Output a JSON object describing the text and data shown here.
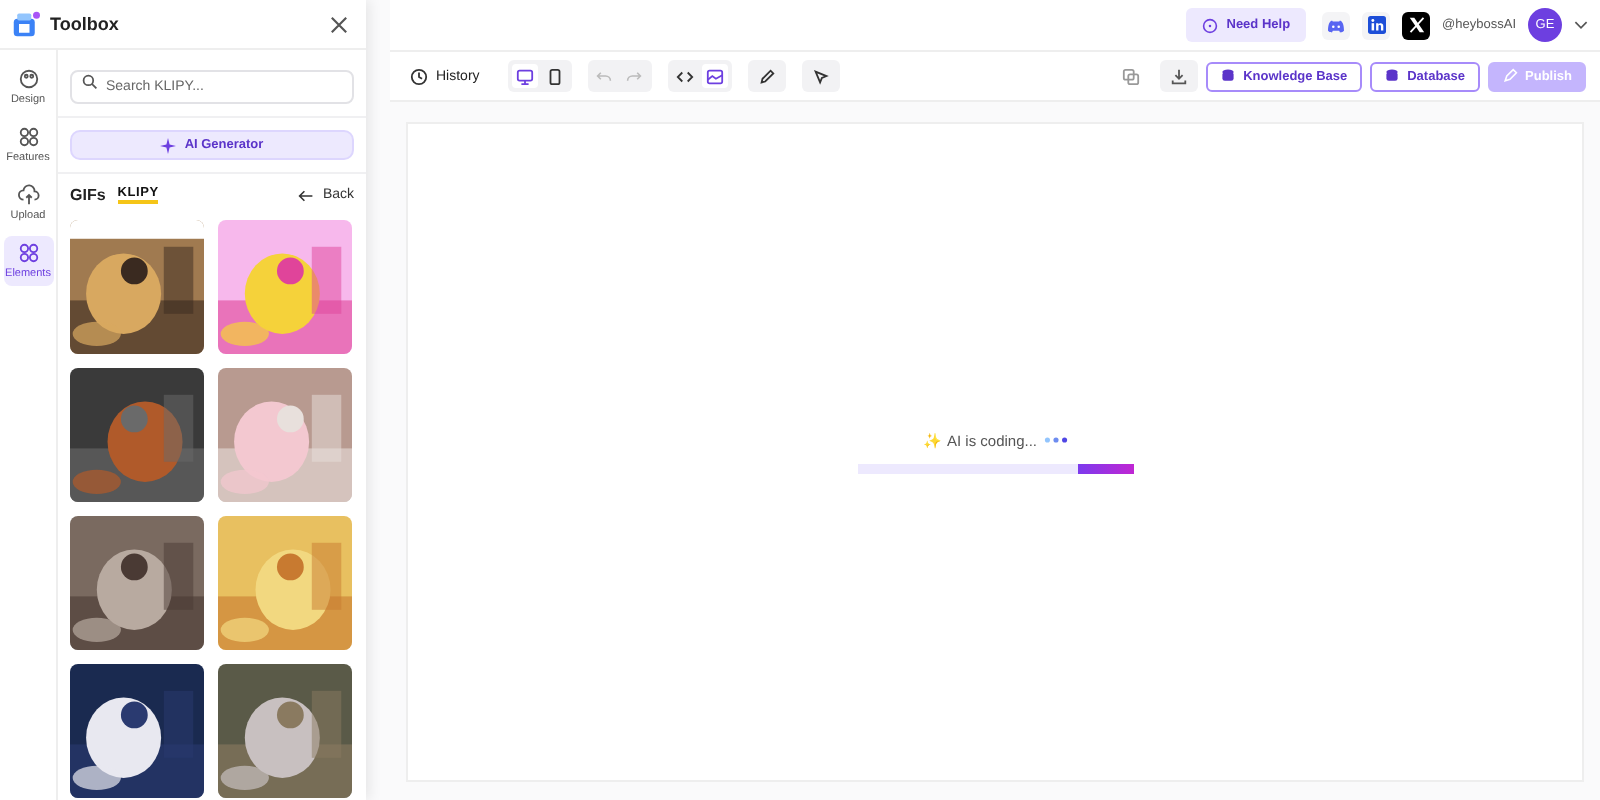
{
  "toolbox": {
    "title": "Toolbox",
    "rail": [
      {
        "kind": "design",
        "label": "Design",
        "selected": false
      },
      {
        "kind": "features",
        "label": "Features",
        "selected": false
      },
      {
        "kind": "upload",
        "label": "Upload",
        "selected": false
      },
      {
        "kind": "elements",
        "label": "Elements",
        "selected": true
      }
    ],
    "search": {
      "placeholder": "Search KLIPY..."
    },
    "ai_button": "AI Generator",
    "section": {
      "title": "GIFs",
      "provider": "KLIPY",
      "back": "Back"
    }
  },
  "topbar": {
    "help": "Need Help",
    "handle": "@heybossAI",
    "avatar": "GE"
  },
  "toolbar": {
    "history": "History",
    "device": [
      {
        "kind": "desktop",
        "selected": true
      },
      {
        "kind": "mobile",
        "selected": false
      }
    ],
    "edit": [
      {
        "kind": "undo",
        "disabled": true
      },
      {
        "kind": "redo",
        "disabled": true
      }
    ],
    "view": [
      {
        "kind": "code",
        "selected": false
      },
      {
        "kind": "preview",
        "selected": true
      }
    ],
    "buttons": [
      {
        "kind": "knowledge",
        "label": "Knowledge Base",
        "disabled": false
      },
      {
        "kind": "database",
        "label": "Database",
        "disabled": false
      },
      {
        "kind": "publish",
        "label": "Publish",
        "disabled": true
      }
    ]
  },
  "canvas": {
    "sparkle": "✨",
    "status": "AI is coding...",
    "level": 0.2
  }
}
